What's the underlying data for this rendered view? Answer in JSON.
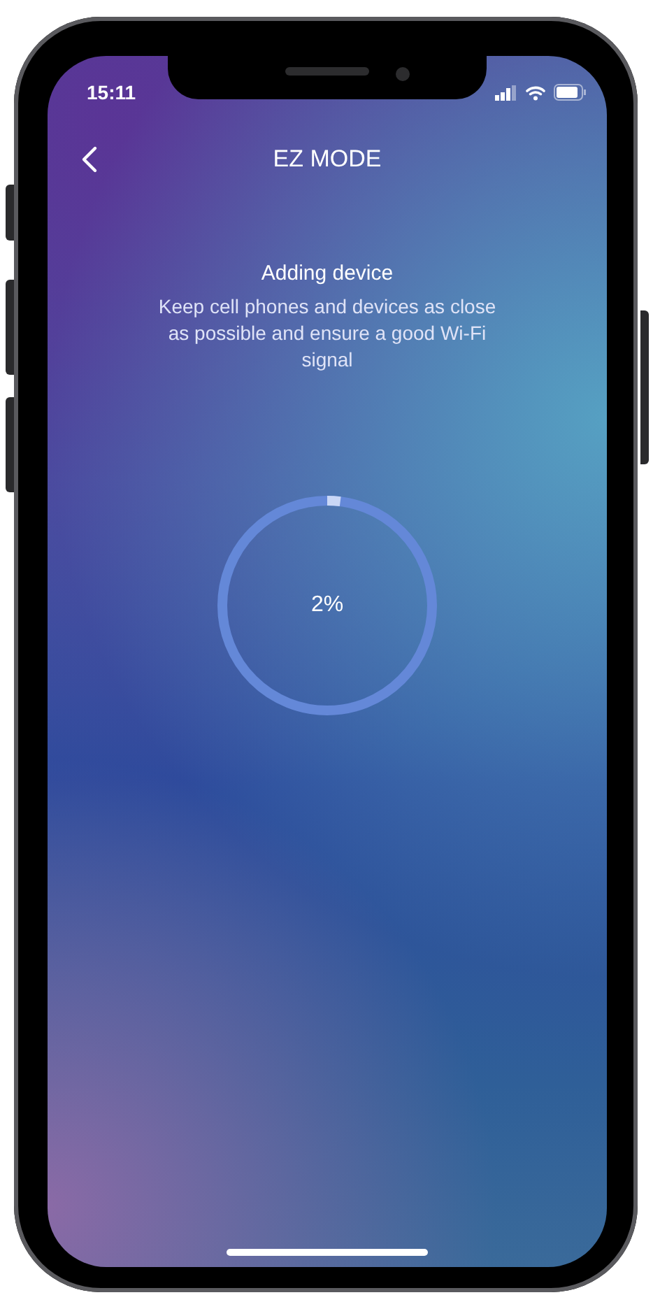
{
  "status_bar": {
    "time": "15:11"
  },
  "nav": {
    "title": "EZ MODE"
  },
  "heading": "Adding device",
  "message": "Keep cell phones and devices as close as possible and ensure a good Wi-Fi signal",
  "progress": {
    "level": 0.02,
    "label": "2%"
  }
}
